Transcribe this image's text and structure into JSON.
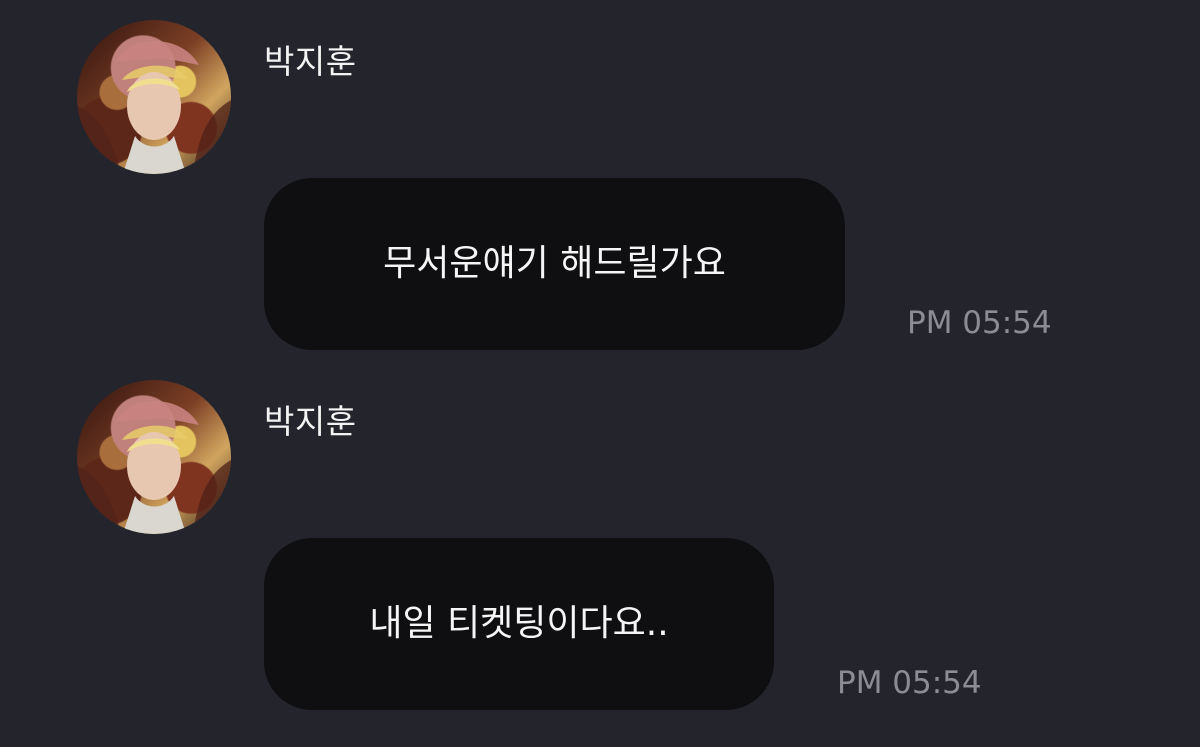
{
  "messages": [
    {
      "sender": "박지훈",
      "text": "무서운얘기 해드릴가요",
      "time": "PM 05:54",
      "avatar_icon": "profile-photo-avatar"
    },
    {
      "sender": "박지훈",
      "text": "내일 티켓팅이다요..",
      "time": "PM 05:54",
      "avatar_icon": "profile-photo-avatar"
    }
  ],
  "colors": {
    "background": "#24252c",
    "bubble": "#0f0f12",
    "text": "#f5f5f5",
    "timestamp": "#8c8d92"
  }
}
